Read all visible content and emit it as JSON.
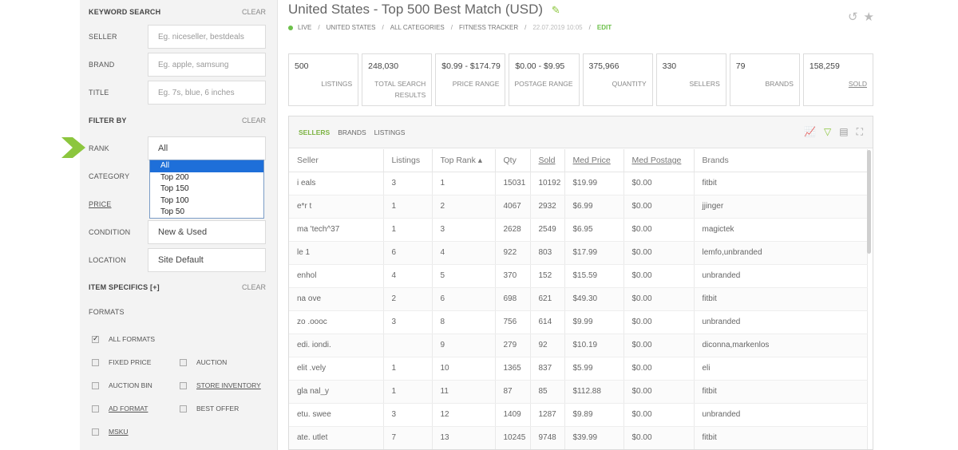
{
  "sidebar": {
    "keyword_search": {
      "label": "KEYWORD SEARCH",
      "clear": "CLEAR"
    },
    "seller": {
      "label": "SELLER",
      "placeholder": "Eg. niceseller, bestdeals"
    },
    "brand": {
      "label": "BRAND",
      "placeholder": "Eg. apple, samsung"
    },
    "title": {
      "label": "TITLE",
      "placeholder": "Eg. 7s, blue, 6 inches"
    },
    "filter_by": {
      "label": "FILTER BY",
      "clear": "CLEAR"
    },
    "rank": {
      "label": "RANK",
      "value": "All",
      "options": [
        "All",
        "Top 200",
        "Top 150",
        "Top 100",
        "Top 50"
      ]
    },
    "category": {
      "label": "CATEGORY"
    },
    "price": {
      "label": "PRICE"
    },
    "condition": {
      "label": "CONDITION",
      "value": "New & Used"
    },
    "location": {
      "label": "LOCATION",
      "value": "Site Default"
    },
    "item_specifics": {
      "label": "ITEM SPECIFICS [+]",
      "clear": "CLEAR"
    },
    "formats": {
      "label": "FORMATS",
      "all_formats": "ALL FORMATS",
      "fixed_price": "FIXED PRICE",
      "auction": "AUCTION",
      "auction_bin": "AUCTION BIN",
      "store_inventory": "STORE INVENTORY",
      "ad_format": "AD FORMAT",
      "best_offer": "BEST OFFER",
      "msku": "MSKU"
    }
  },
  "header": {
    "title": "United States - Top 500 Best Match (USD)",
    "breadcrumbs": [
      "LIVE",
      "UNITED STATES",
      "ALL CATEGORIES",
      "FITNESS TRACKER",
      "22.07.2019 10:05"
    ],
    "edit": "EDIT"
  },
  "stats": [
    {
      "value": "500",
      "label": "LISTINGS"
    },
    {
      "value": "248,030",
      "label": "TOTAL SEARCH RESULTS"
    },
    {
      "value": "$0.99 - $174.79",
      "label": "PRICE RANGE"
    },
    {
      "value": "$0.00 - $9.95",
      "label": "POSTAGE RANGE"
    },
    {
      "value": "375,966",
      "label": "QUANTITY"
    },
    {
      "value": "330",
      "label": "SELLERS"
    },
    {
      "value": "79",
      "label": "BRANDS"
    },
    {
      "value": "158,259",
      "label": "SOLD"
    }
  ],
  "tabs": [
    "SELLERS",
    "BRANDS",
    "LISTINGS"
  ],
  "table": {
    "columns": [
      "Seller",
      "Listings",
      "Top Rank ▴",
      "Qty",
      "Sold",
      "Med Price",
      "Med Postage",
      "Brands"
    ],
    "rows": [
      [
        "i   eals",
        "3",
        "1",
        "15031",
        "10192",
        "$19.99",
        "$0.00",
        "fitbit"
      ],
      [
        "e*r   t",
        "1",
        "2",
        "4067",
        "2932",
        "$6.99",
        "$0.00",
        "jjinger"
      ],
      [
        "ma  'tech^37",
        "1",
        "3",
        "2628",
        "2549",
        "$6.95",
        "$0.00",
        "magictek"
      ],
      [
        "le   1",
        "6",
        "4",
        "922",
        "803",
        "$17.99",
        "$0.00",
        "lemfo,unbranded"
      ],
      [
        "   enhol",
        "4",
        "5",
        "370",
        "152",
        "$15.59",
        "$0.00",
        "unbranded"
      ],
      [
        "na   ove",
        "2",
        "6",
        "698",
        "621",
        "$49.30",
        "$0.00",
        "fitbit"
      ],
      [
        "zo  .oooc",
        "3",
        "8",
        "756",
        "614",
        "$9.99",
        "$0.00",
        "unbranded"
      ],
      [
        "edi.   iondi.",
        "",
        "9",
        "279",
        "92",
        "$10.19",
        "$0.00",
        "diconna,markenlos"
      ],
      [
        "elit  .vely",
        "1",
        "10",
        "1365",
        "837",
        "$5.99",
        "$0.00",
        "eli"
      ],
      [
        "gla   nal_y",
        "1",
        "11",
        "87",
        "85",
        "$112.88",
        "$0.00",
        "fitbit"
      ],
      [
        "etu.  swee",
        "3",
        "12",
        "1409",
        "1287",
        "$9.89",
        "$0.00",
        "unbranded"
      ],
      [
        "ate.  utlet",
        "7",
        "13",
        "10245",
        "9748",
        "$39.99",
        "$0.00",
        "fitbit"
      ]
    ]
  }
}
